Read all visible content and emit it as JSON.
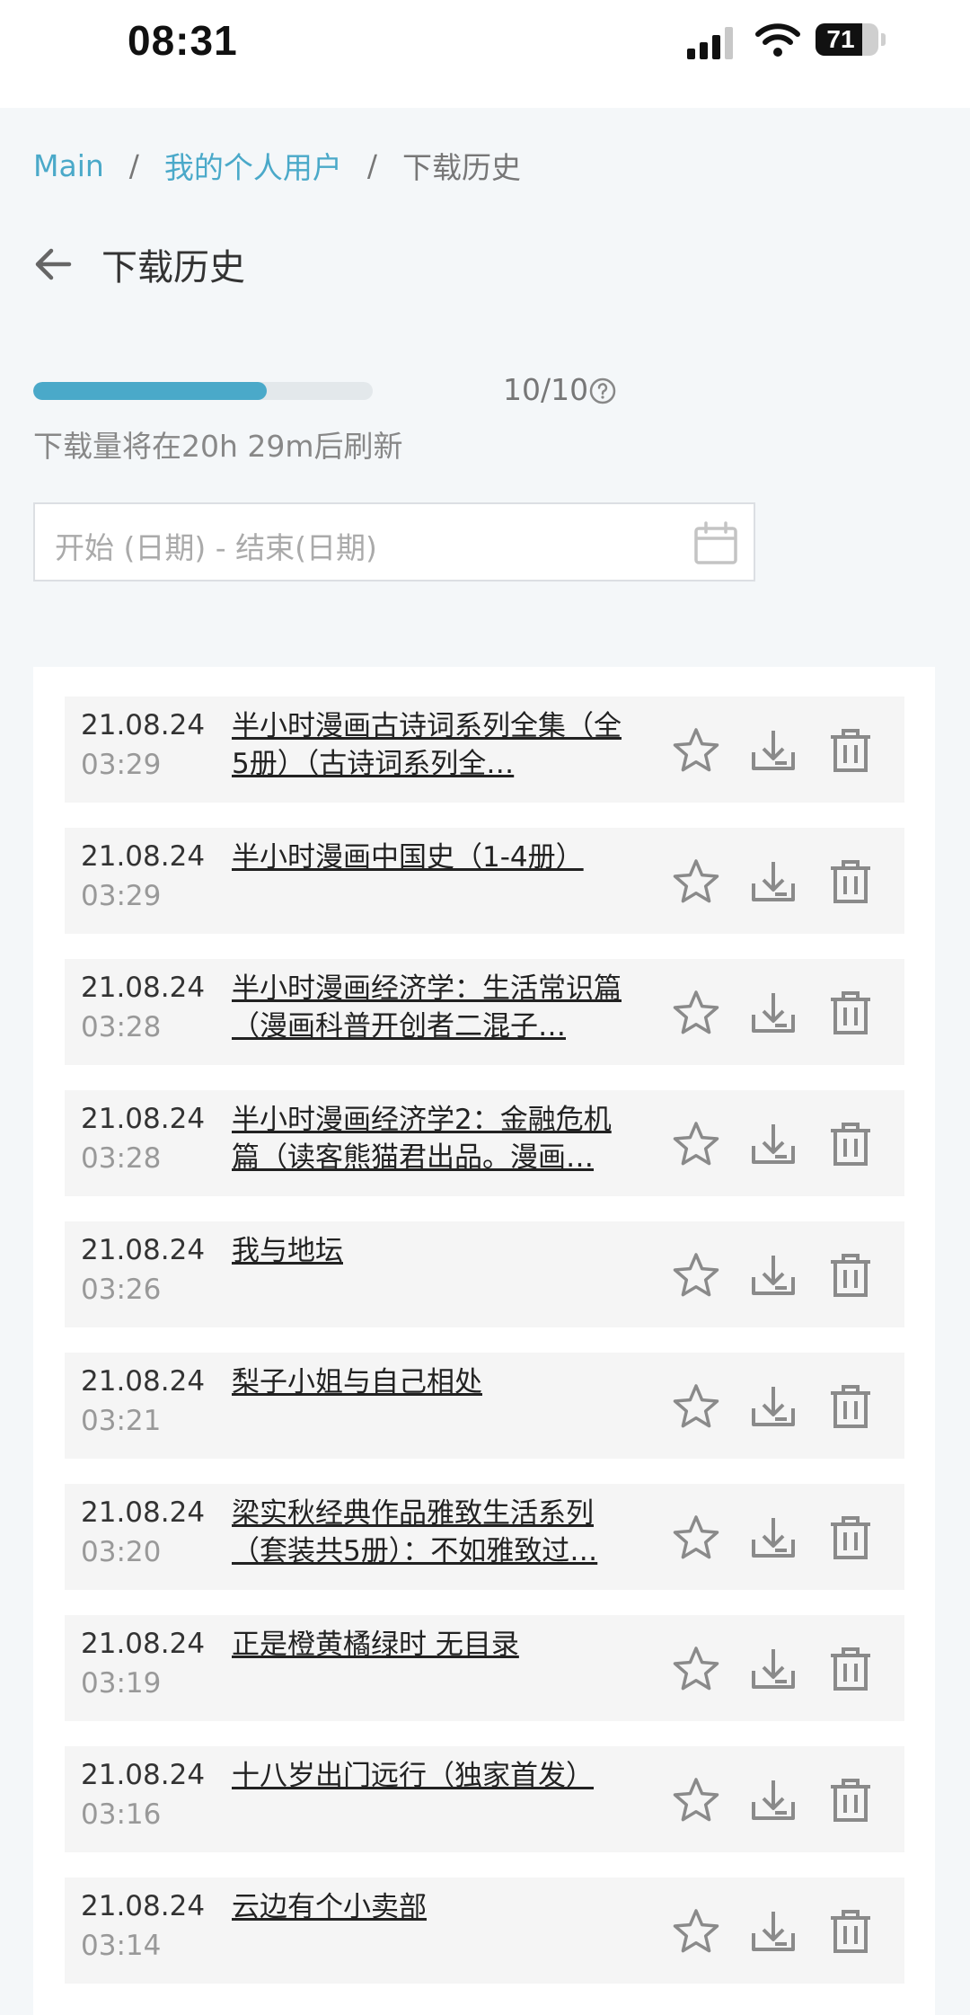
{
  "status_bar": {
    "time": "08:31",
    "battery": "71"
  },
  "breadcrumb": {
    "main": "Main",
    "profile": "我的个人用户",
    "current": "下载历史",
    "separator": "/"
  },
  "page": {
    "title": "下载历史"
  },
  "quota": {
    "used": 10,
    "total": 10,
    "text": "10/10",
    "refresh_note": "下载量将在20h 29m后刷新",
    "fill_fraction": 0.72
  },
  "date_filter": {
    "placeholder": "开始 (日期) - 结束(日期)"
  },
  "downloads": [
    {
      "date": "21.08.24",
      "time": "03:29",
      "title": "半小时漫画古诗词系列全集（全5册）（古诗词系列全…"
    },
    {
      "date": "21.08.24",
      "time": "03:29",
      "title": "半小时漫画中国史（1-4册）"
    },
    {
      "date": "21.08.24",
      "time": "03:28",
      "title": "半小时漫画经济学：生活常识篇（漫画科普开创者二混子…"
    },
    {
      "date": "21.08.24",
      "time": "03:28",
      "title": "半小时漫画经济学2：金融危机篇（读客熊猫君出品。漫画…"
    },
    {
      "date": "21.08.24",
      "time": "03:26",
      "title": "我与地坛"
    },
    {
      "date": "21.08.24",
      "time": "03:21",
      "title": "梨子小姐与自己相处"
    },
    {
      "date": "21.08.24",
      "time": "03:20",
      "title": "梁实秋经典作品雅致生活系列（套装共5册）：不如雅致过…"
    },
    {
      "date": "21.08.24",
      "time": "03:19",
      "title": "正是橙黄橘绿时 无目录"
    },
    {
      "date": "21.08.24",
      "time": "03:16",
      "title": "十八岁出门远行（独家首发）"
    },
    {
      "date": "21.08.24",
      "time": "03:14",
      "title": "云边有个小卖部"
    }
  ],
  "colors": {
    "accent": "#4aa9c9",
    "icon": "#8a8a8a",
    "row_bg": "#f5f5f5"
  },
  "icons": {
    "favorite": "star-icon",
    "download": "download-icon",
    "delete": "trash-icon"
  }
}
